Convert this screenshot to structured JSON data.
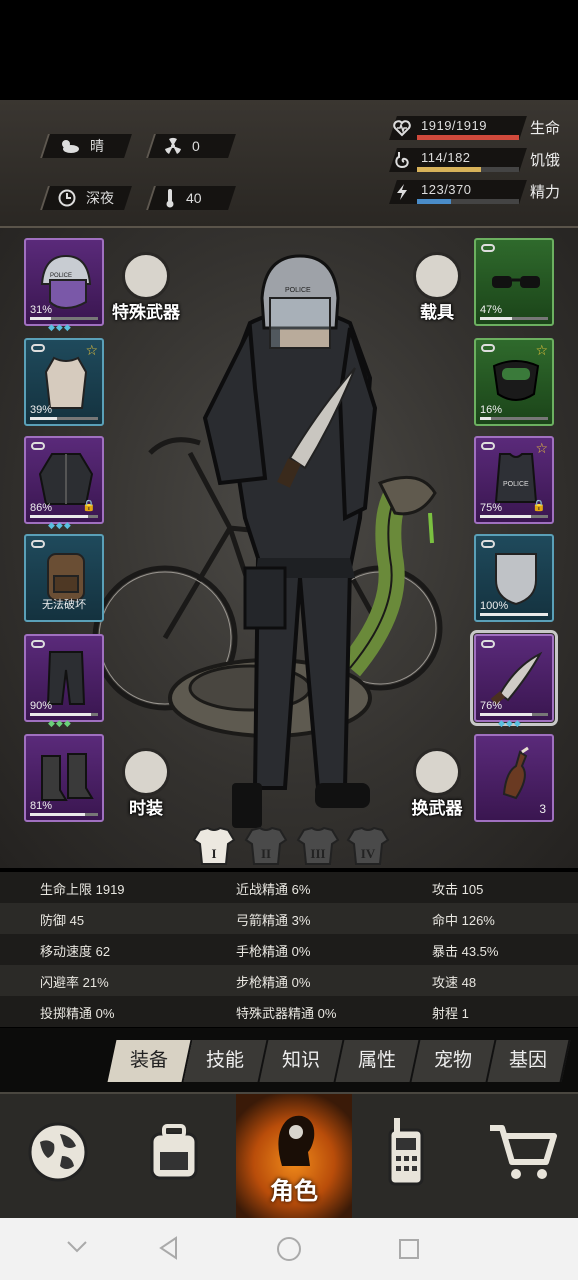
{
  "status": {
    "weather": "晴",
    "radiation": "0",
    "time_of_day": "深夜",
    "temperature": "40",
    "health": {
      "value": "1919/1919",
      "label": "生命",
      "ratio": 1.0,
      "color": "#d04a3c"
    },
    "hunger": {
      "value": "114/182",
      "label": "饥饿",
      "ratio": 0.626,
      "color": "#d8b35a"
    },
    "energy": {
      "value": "123/370",
      "label": "精力",
      "ratio": 0.332,
      "color": "#4a8cc8"
    }
  },
  "equipment": {
    "left": [
      {
        "name": "police-helmet",
        "pct": "31%",
        "durability": 0.31,
        "rarity": "purple",
        "gems": "◆◆◆"
      },
      {
        "name": "shirt",
        "pct": "39%",
        "durability": 0.39,
        "rarity": "blue"
      },
      {
        "name": "jacket",
        "pct": "86%",
        "durability": 0.86,
        "rarity": "purple",
        "gems": "◆◆◆"
      },
      {
        "name": "backpack",
        "note": "无法破坏",
        "rarity": "blue"
      },
      {
        "name": "pants",
        "pct": "90%",
        "durability": 0.9,
        "rarity": "purple",
        "gems": "◆◆◆"
      },
      {
        "name": "boots",
        "pct": "81%",
        "durability": 0.81,
        "rarity": "purple"
      }
    ],
    "right": [
      {
        "name": "glasses",
        "pct": "47%",
        "durability": 0.47,
        "rarity": "green"
      },
      {
        "name": "gas-mask",
        "pct": "16%",
        "durability": 0.16,
        "rarity": "green"
      },
      {
        "name": "police-vest",
        "pct": "75%",
        "durability": 0.75,
        "rarity": "purple"
      },
      {
        "name": "shield",
        "pct": "100%",
        "durability": 1.0,
        "rarity": "blue"
      },
      {
        "name": "machete",
        "pct": "76%",
        "durability": 0.76,
        "rarity": "purple",
        "gems": "◆◆◆"
      },
      {
        "name": "molotov",
        "count": "3",
        "rarity": "purple"
      }
    ]
  },
  "buttons": {
    "special_weapon": "特殊武器",
    "vehicle": "载具",
    "fashion": "时装",
    "swap_weapon": "换武器"
  },
  "outfit_tabs": [
    "I",
    "II",
    "III",
    "IV"
  ],
  "stats": [
    [
      "生命上限 1919",
      "近战精通 6%",
      "攻击 105"
    ],
    [
      "防御 45",
      "弓箭精通 3%",
      "命中 126%"
    ],
    [
      "移动速度 62",
      "手枪精通 0%",
      "暴击 43.5%"
    ],
    [
      "闪避率 21%",
      "步枪精通 0%",
      "攻速 48"
    ],
    [
      "投掷精通 0%",
      "特殊武器精通 0%",
      "射程 1"
    ]
  ],
  "tabs": [
    "装备",
    "技能",
    "知识",
    "属性",
    "宠物",
    "基因"
  ],
  "nav": {
    "character": "角色"
  }
}
